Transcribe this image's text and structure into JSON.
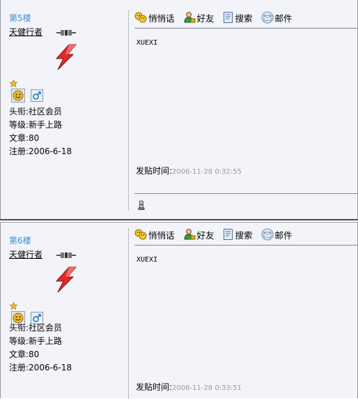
{
  "posts": [
    {
      "floor": "第5楼",
      "author": "天健行者",
      "title_label": "头衔:",
      "title": "社区会员",
      "level_label": "等级:",
      "level": "新手上路",
      "posts_label": "文章:",
      "posts_count": "80",
      "reg_label": "注册:",
      "reg_date": "2006-6-18",
      "toolbar": {
        "whisper": "悄悄话",
        "friend": "好友",
        "search": "搜索",
        "mail": "邮件"
      },
      "content": "XUEXI",
      "time_label": "发贴时间:",
      "time": "2006-11-28 0:32:55"
    },
    {
      "floor": "第6楼",
      "author": "天健行者",
      "title_label": "头衔:",
      "title": "社区会员",
      "level_label": "等级:",
      "level": "新手上路",
      "posts_label": "文章:",
      "posts_count": "80",
      "reg_label": "注册:",
      "reg_date": "2006-6-18",
      "toolbar": {
        "whisper": "悄悄话",
        "friend": "好友",
        "search": "搜索",
        "mail": "邮件"
      },
      "content": "XUEXI",
      "time_label": "发贴时间:",
      "time": "2006-11-28 0:33:51"
    }
  ],
  "colors": {
    "floor": "#3a8fcf",
    "background": "#f2f4fa",
    "time": "#9a9a9a",
    "avatar": "#d8262a"
  }
}
